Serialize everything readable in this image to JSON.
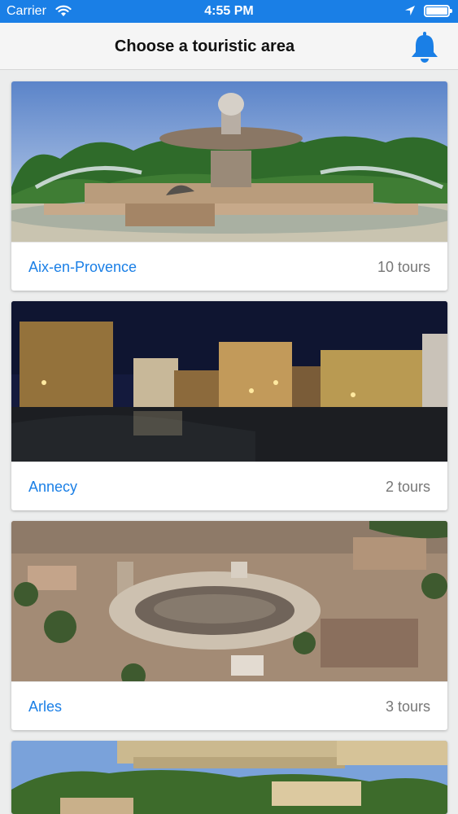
{
  "status_bar": {
    "carrier": "Carrier",
    "time": "4:55 PM",
    "icons": [
      "wifi-icon",
      "location-arrow-icon",
      "battery-icon"
    ]
  },
  "nav": {
    "title": "Choose a touristic area",
    "icon": "bell-icon",
    "accent_color": "#1a7fe6"
  },
  "areas": [
    {
      "name": "Aix-en-Provence",
      "tours": "10 tours"
    },
    {
      "name": "Annecy",
      "tours": "2 tours"
    },
    {
      "name": "Arles",
      "tours": "3 tours"
    },
    {
      "name": "",
      "tours": ""
    }
  ]
}
